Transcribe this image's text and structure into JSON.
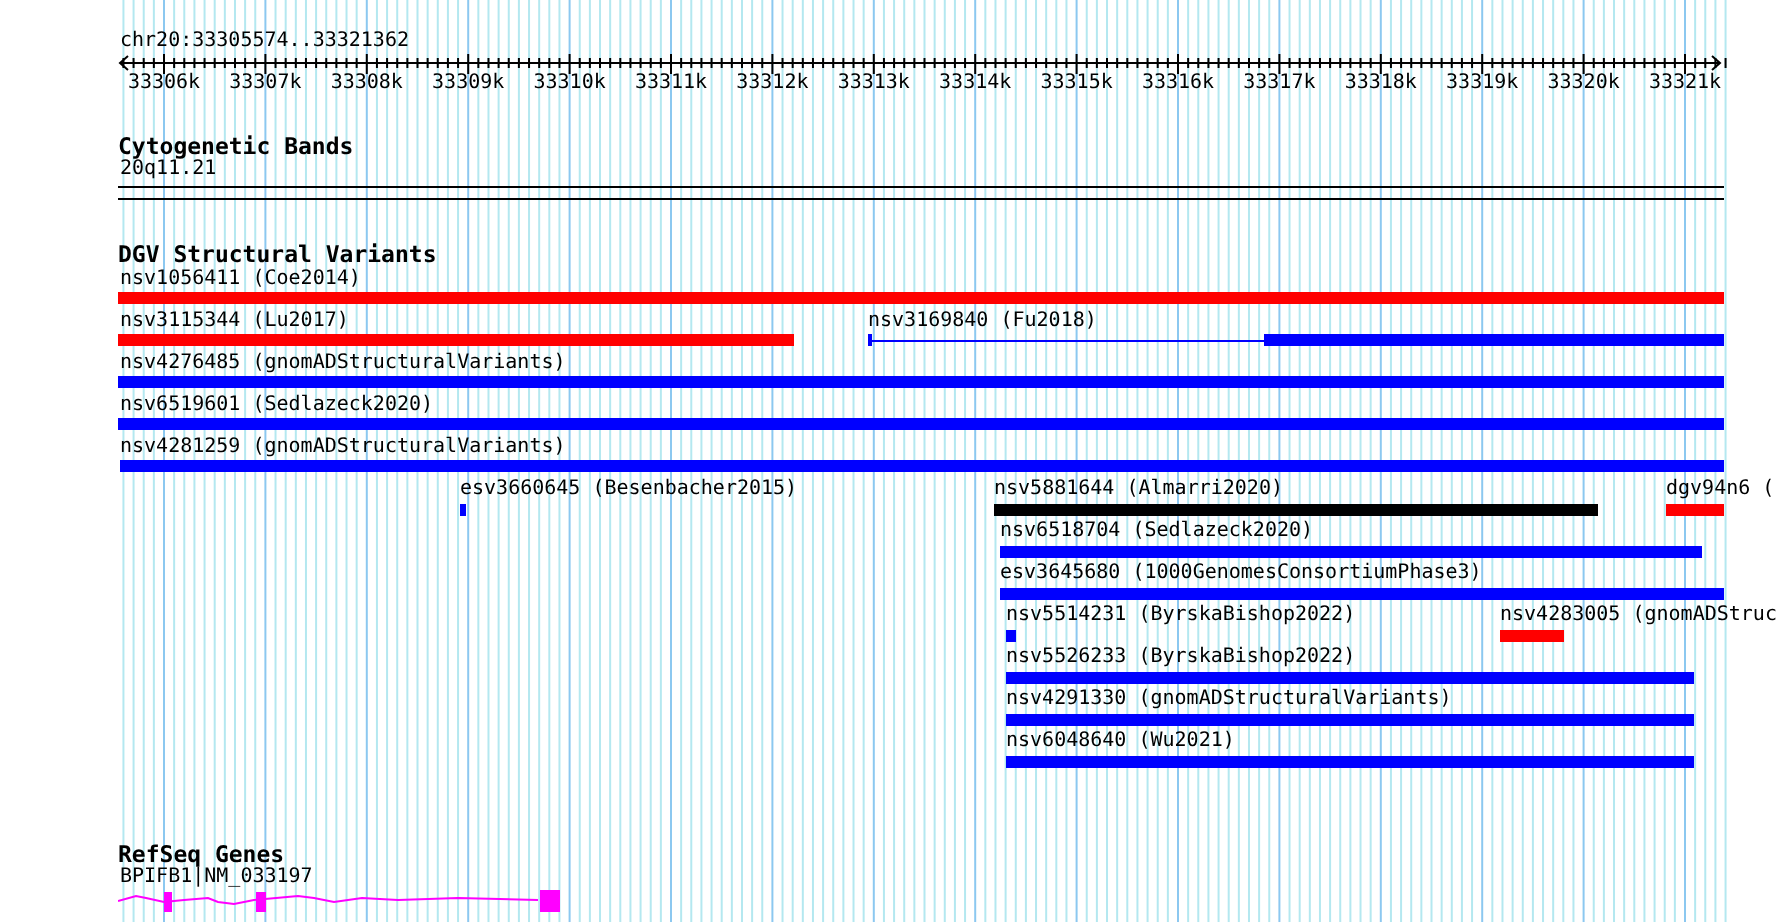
{
  "ruler": {
    "location": "chr20:33305574..33321362",
    "ticks": [
      "33306k",
      "33307k",
      "33308k",
      "33309k",
      "33310k",
      "33311k",
      "33312k",
      "33313k",
      "33314k",
      "33315k",
      "33316k",
      "33317k",
      "33318k",
      "33319k",
      "33320k",
      "33321k"
    ]
  },
  "tracks": [
    {
      "kind": "bands",
      "title": "Cytogenetic Bands",
      "items": [
        {
          "label": "20q11.21"
        }
      ]
    },
    {
      "kind": "variants",
      "title": "DGV Structural Variants",
      "items": [
        {
          "label": "nsv1056411 (Coe2014)",
          "color": "#ff0000",
          "kind": "bar"
        },
        {
          "label": "nsv3115344 (Lu2017)",
          "color": "#ff0000",
          "kind": "bar"
        },
        {
          "label": "nsv3169840 (Fu2018)",
          "color": "#0000ff",
          "kind": "split"
        },
        {
          "label": "nsv4276485 (gnomADStructuralVariants)",
          "color": "#0000ff",
          "kind": "bar"
        },
        {
          "label": "nsv6519601 (Sedlazeck2020)",
          "color": "#0000ff",
          "kind": "bar"
        },
        {
          "label": "nsv4281259 (gnomADStructuralVariants)",
          "color": "#0000ff",
          "kind": "bar"
        },
        {
          "label": "esv3660645 (Besenbacher2015)",
          "color": "#0000ff",
          "kind": "bar"
        },
        {
          "label": "nsv5881644 (Almarri2020)",
          "color": "#000000",
          "kind": "bar"
        },
        {
          "label": "dgv94n6 (",
          "color": "#ff0000",
          "kind": "bar"
        },
        {
          "label": "nsv6518704 (Sedlazeck2020)",
          "color": "#0000ff",
          "kind": "bar"
        },
        {
          "label": "esv3645680 (1000GenomesConsortiumPhase3)",
          "color": "#0000ff",
          "kind": "bar"
        },
        {
          "label": "nsv5514231 (ByrskaBishop2022)",
          "color": "#0000ff",
          "kind": "bar"
        },
        {
          "label": "nsv4283005 (gnomADStruc",
          "color": "#ff0000",
          "kind": "bar"
        },
        {
          "label": "nsv5526233 (ByrskaBishop2022)",
          "color": "#0000ff",
          "kind": "bar"
        },
        {
          "label": "nsv4291330 (gnomADStructuralVariants)",
          "color": "#0000ff",
          "kind": "bar"
        },
        {
          "label": "nsv6048640 (Wu2021)",
          "color": "#0000ff",
          "kind": "bar"
        }
      ]
    },
    {
      "kind": "genes",
      "title": "RefSeq Genes",
      "items": [
        {
          "label": "BPIFB1|NM_033197"
        }
      ]
    }
  ]
}
